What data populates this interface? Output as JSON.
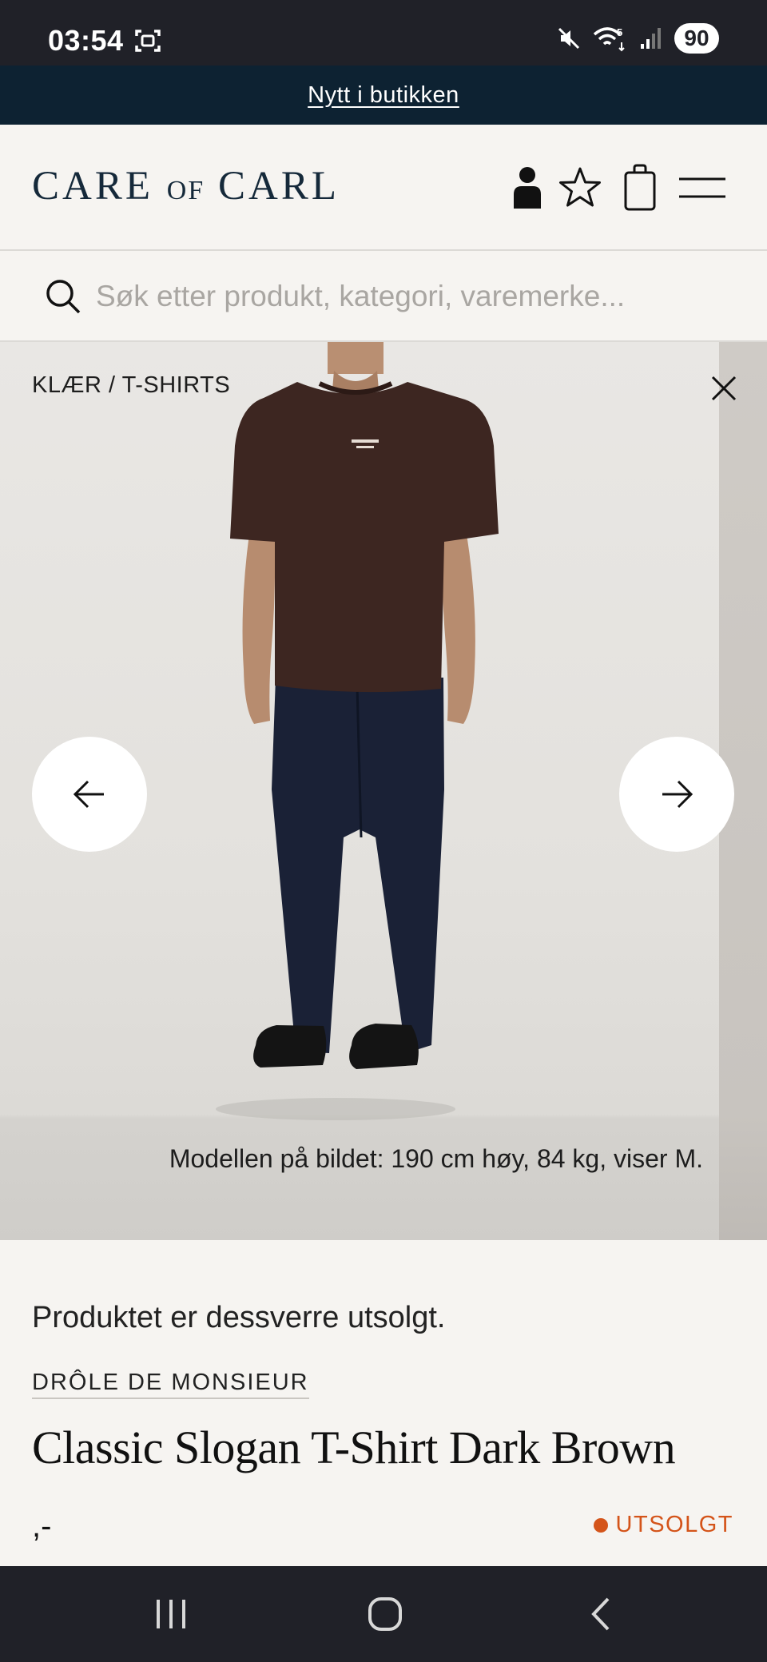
{
  "status_bar": {
    "time": "03:54",
    "battery": "90",
    "icons": [
      "screenshot-icon",
      "mute-icon",
      "wifi-icon",
      "signal-icon"
    ]
  },
  "announcement": {
    "link_text": "Nytt i butikken"
  },
  "header": {
    "logo_part1": "CARE ",
    "logo_of": "OF",
    "logo_part2": " CARL",
    "icons": [
      "account-icon",
      "favorites-star-icon",
      "cart-bag-icon",
      "menu-hamburger-icon"
    ]
  },
  "search": {
    "placeholder": "Søk etter produkt, kategori, varemerke..."
  },
  "gallery": {
    "breadcrumb_category": "KLÆR",
    "breadcrumb_separator": " / ",
    "breadcrumb_subcategory": "T-SHIRTS",
    "caption": "Modellen på bildet: 190 cm høy, 84 kg, viser M."
  },
  "product": {
    "soldout_message": "Produktet er dessverre utsolgt.",
    "brand": "DRÔLE DE MONSIEUR",
    "title": "Classic Slogan T-Shirt Dark Brown",
    "price": ",-",
    "stock_status": "UTSOLGT",
    "stock_color": "#d4541a"
  },
  "colors": {
    "announcement_bg": "#0d2232",
    "logo": "#15293a",
    "system_bar": "#202128"
  }
}
